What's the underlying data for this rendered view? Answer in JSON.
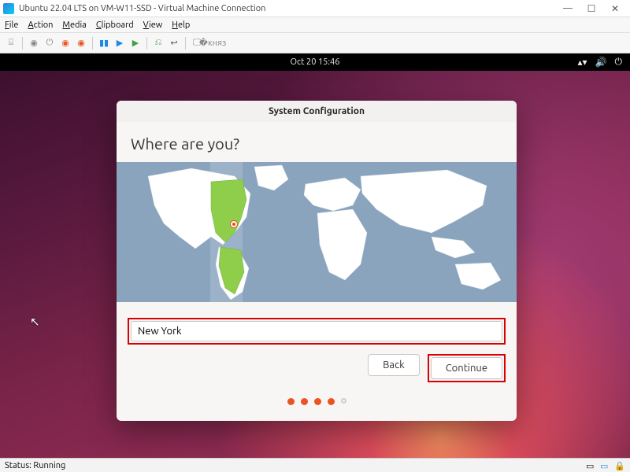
{
  "host": {
    "window_title": "Ubuntu 22.04 LTS on VM-W11-SSD - Virtual Machine Connection",
    "menu": {
      "file": "File",
      "action": "Action",
      "media": "Media",
      "clipboard": "Clipboard",
      "view": "View",
      "help": "Help"
    },
    "status_label": "Status:",
    "status_value": "Running"
  },
  "gnome": {
    "clock": "Oct 20  15:46"
  },
  "installer": {
    "title": "System Configuration",
    "heading": "Where are you?",
    "location_value": "New York",
    "back_label": "Back",
    "continue_label": "Continue",
    "progress": {
      "total": 5,
      "current": 4
    }
  },
  "icons": {
    "network": "▲",
    "volume": "🔊",
    "power": "⏻"
  }
}
